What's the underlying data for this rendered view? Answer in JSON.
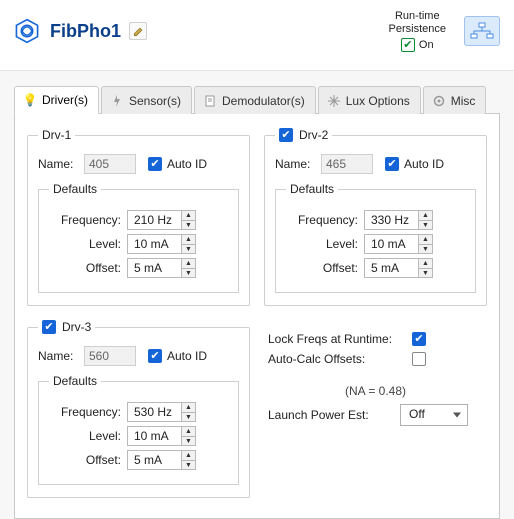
{
  "header": {
    "title": "FibPho1",
    "persistence": {
      "label1": "Run-time",
      "label2": "Persistence",
      "state": "On"
    }
  },
  "tabs": [
    {
      "label": "Driver(s)"
    },
    {
      "label": "Sensor(s)"
    },
    {
      "label": "Demodulator(s)"
    },
    {
      "label": "Lux Options"
    },
    {
      "label": "Misc"
    }
  ],
  "labels": {
    "name": "Name:",
    "autoId": "Auto ID",
    "defaults": "Defaults",
    "frequency": "Frequency:",
    "level": "Level:",
    "offset": "Offset:",
    "lockFreqs": "Lock Freqs at Runtime:",
    "autoCalc": "Auto-Calc Offsets:",
    "na": "(NA  = 0.48)",
    "launch": "Launch Power Est:"
  },
  "drivers": [
    {
      "id": "Drv-1",
      "enabled": true,
      "name": "405",
      "autoId": true,
      "frequency": "210 Hz",
      "level": "10 mA",
      "offset": "5 mA"
    },
    {
      "id": "Drv-2",
      "enabled": true,
      "name": "465",
      "autoId": true,
      "frequency": "330 Hz",
      "level": "10 mA",
      "offset": "5 mA"
    },
    {
      "id": "Drv-3",
      "enabled": true,
      "name": "560",
      "autoId": true,
      "frequency": "530 Hz",
      "level": "10 mA",
      "offset": "5 mA"
    }
  ],
  "options": {
    "lockFreqs": true,
    "autoCalc": false,
    "launchPower": "Off"
  }
}
